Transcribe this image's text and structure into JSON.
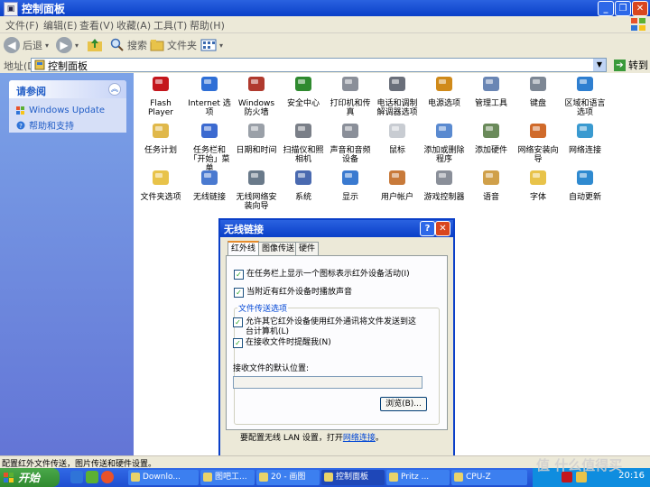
{
  "window": {
    "title": "控制面板"
  },
  "menu": [
    "文件(F)",
    "编辑(E)",
    "查看(V)",
    "收藏(A)",
    "工具(T)",
    "帮助(H)"
  ],
  "toolbar": {
    "back": "后退",
    "search": "搜索",
    "folders": "文件夹"
  },
  "address": {
    "label": "地址(D)",
    "value": "控制面板",
    "go": "转到"
  },
  "see_also": {
    "title": "请参阅",
    "links": [
      "Windows Update",
      "帮助和支持"
    ]
  },
  "items": [
    {
      "label": "Flash Player",
      "icon": "flash-icon",
      "color": "#c4161c"
    },
    {
      "label": "Internet 选项",
      "icon": "globe-icon",
      "color": "#2f6fd6"
    },
    {
      "label": "Windows 防火墙",
      "icon": "firewall-icon",
      "color": "#b03a2e"
    },
    {
      "label": "安全中心",
      "icon": "shield-icon",
      "color": "#2f8a2f"
    },
    {
      "label": "打印机和传真",
      "icon": "printer-icon",
      "color": "#8a8f99"
    },
    {
      "label": "电话和调制解调器选项",
      "icon": "phone-icon",
      "color": "#6a6f7a"
    },
    {
      "label": "电源选项",
      "icon": "power-icon",
      "color": "#d08a1a"
    },
    {
      "label": "管理工具",
      "icon": "admin-tools-icon",
      "color": "#6a86b4"
    },
    {
      "label": "键盘",
      "icon": "keyboard-icon",
      "color": "#7d8794"
    },
    {
      "label": "区域和语言选项",
      "icon": "region-globe-icon",
      "color": "#2f7fd0"
    },
    {
      "label": "任务计划",
      "icon": "scheduler-icon",
      "color": "#e0b84a"
    },
    {
      "label": "任务栏和「开始」菜单",
      "icon": "taskbar-icon",
      "color": "#3c6ad0"
    },
    {
      "label": "日期和时间",
      "icon": "clock-icon",
      "color": "#9aa0a8"
    },
    {
      "label": "扫描仪和照相机",
      "icon": "camera-icon",
      "color": "#7a7f88"
    },
    {
      "label": "声音和音频设备",
      "icon": "speaker-icon",
      "color": "#8a8f99"
    },
    {
      "label": "鼠标",
      "icon": "mouse-icon",
      "color": "#c8ccd2"
    },
    {
      "label": "添加或删除程序",
      "icon": "add-remove-icon",
      "color": "#5a8ad0"
    },
    {
      "label": "添加硬件",
      "icon": "add-hardware-icon",
      "color": "#6a8a5a"
    },
    {
      "label": "网络安装向导",
      "icon": "home-network-icon",
      "color": "#d06a2a"
    },
    {
      "label": "网络连接",
      "icon": "network-icon",
      "color": "#3a9ad0"
    },
    {
      "label": "文件夹选项",
      "icon": "folder-icon",
      "color": "#e8c34a"
    },
    {
      "label": "无线链接",
      "icon": "infrared-icon",
      "color": "#4a7ad0"
    },
    {
      "label": "无线网络安装向导",
      "icon": "wireless-icon",
      "color": "#6a7a8a"
    },
    {
      "label": "系统",
      "icon": "system-icon",
      "color": "#4a6ab0"
    },
    {
      "label": "显示",
      "icon": "display-icon",
      "color": "#3a7ad0"
    },
    {
      "label": "用户帐户",
      "icon": "users-icon",
      "color": "#c87a3a"
    },
    {
      "label": "游戏控制器",
      "icon": "gamepad-icon",
      "color": "#8a8f99"
    },
    {
      "label": "语音",
      "icon": "speech-icon",
      "color": "#d0a04a"
    },
    {
      "label": "字体",
      "icon": "fonts-icon",
      "color": "#e8c34a"
    },
    {
      "label": "自动更新",
      "icon": "update-icon",
      "color": "#2f8ad0"
    }
  ],
  "dialog": {
    "title": "无线链接",
    "tabs": [
      "红外线",
      "图像传送",
      "硬件"
    ],
    "check1": "在任务栏上显示一个图标表示红外设备活动(I)",
    "check2": "当附近有红外设备时播放声音",
    "group_label": "文件传送选项",
    "check3": "允许其它红外设备使用红外通讯将文件发送到这台计算机(L)",
    "check4": "在接收文件时提醒我(N)",
    "path_label": "接收文件的默认位置:",
    "browse": "浏览(B)...",
    "footer_prefix": "要配置无线 LAN 设置，打开",
    "footer_link": "网络连接",
    "footer_suffix": "。"
  },
  "status": "配置红外文件传送，图片传送和硬件设置。",
  "taskbar": {
    "start": "开始",
    "tasks": [
      "Downlo...",
      "图吧工...",
      "20 - 画图",
      "控制面板",
      "Pritz ...",
      "CPU-Z"
    ],
    "clock": "20:16"
  },
  "watermark": "值 什么值得买"
}
